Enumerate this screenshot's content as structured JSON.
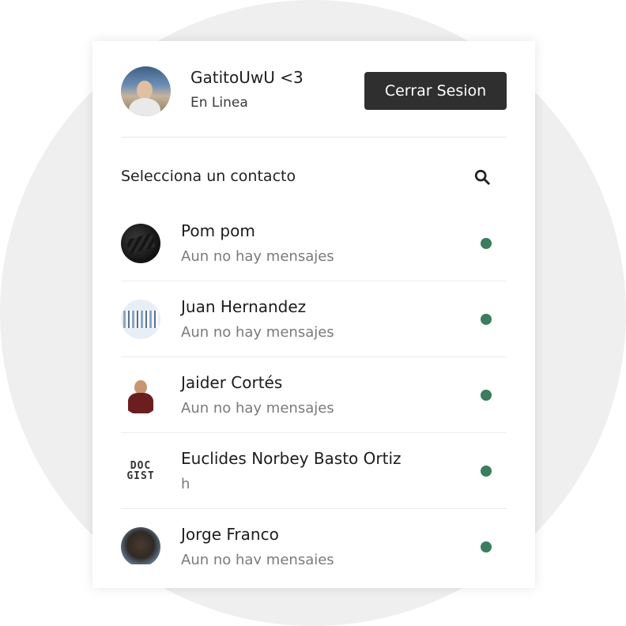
{
  "user": {
    "name": "GatitoUwU <3",
    "status": "En Linea"
  },
  "header": {
    "logout_label": "Cerrar Sesion"
  },
  "contacts_section": {
    "label": "Selecciona un contacto",
    "search_icon": "search-icon"
  },
  "contacts": [
    {
      "name": "Pom pom",
      "last_message": "Aun no hay mensajes",
      "online": true
    },
    {
      "name": "Juan Hernandez",
      "last_message": "Aun no hay mensajes",
      "online": true
    },
    {
      "name": "Jaider Cortés",
      "last_message": "Aun no hay mensajes",
      "online": true
    },
    {
      "name": "Euclides Norbey Basto Ortiz",
      "last_message": "h",
      "online": true,
      "avatar_text": "DOC GIST"
    },
    {
      "name": "Jorge Franco",
      "last_message": "Aun no hay mensajes",
      "online": true
    }
  ],
  "colors": {
    "online_dot": "#3a7d5f",
    "button_bg": "#2f2f2f",
    "background_circle": "#efefef"
  }
}
